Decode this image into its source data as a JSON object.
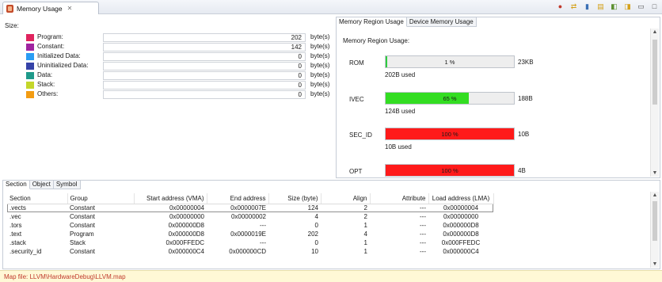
{
  "view": {
    "title": "Memory Usage",
    "close_icon": "close-icon"
  },
  "toolbar": {
    "icons": [
      "refresh-icon",
      "link-icon",
      "filter-icon",
      "export-icon",
      "collapse-icon",
      "expand-icon",
      "minimize-icon",
      "maximize-icon"
    ]
  },
  "size": {
    "title": "Size:",
    "unit": "byte(s)",
    "rows": [
      {
        "label": "Program:",
        "value": "202",
        "color": "#e0245e"
      },
      {
        "label": "Constant:",
        "value": "142",
        "color": "#a024a0"
      },
      {
        "label": "Initialized Data:",
        "value": "0",
        "color": "#2a9df4"
      },
      {
        "label": "Uninitialized Data:",
        "value": "0",
        "color": "#3543a8"
      },
      {
        "label": "Data:",
        "value": "0",
        "color": "#1f9a8a"
      },
      {
        "label": "Stack:",
        "value": "0",
        "color": "#c4d62a"
      },
      {
        "label": "Others:",
        "value": "0",
        "color": "#f39c12"
      }
    ]
  },
  "region": {
    "tabs": [
      "Memory Region Usage",
      "Device Memory Usage"
    ],
    "title": "Memory Region Usage:",
    "items": [
      {
        "name": "ROM",
        "percent_label": "1 %",
        "fill_fraction": 0.01,
        "fill_color": "#2ecc40",
        "size": "23KB",
        "used": "202B used"
      },
      {
        "name": "IVEC",
        "percent_label": "65 %",
        "fill_fraction": 0.65,
        "fill_color": "#33dd22",
        "size": "188B",
        "used": "124B used"
      },
      {
        "name": "SEC_ID",
        "percent_label": "100 %",
        "fill_fraction": 1.0,
        "fill_color": "#ff1a1a",
        "size": "10B",
        "used": "10B used"
      },
      {
        "name": "OPT",
        "percent_label": "100 %",
        "fill_fraction": 1.0,
        "fill_color": "#ff1a1a",
        "size": "4B",
        "used": ""
      }
    ]
  },
  "bottom": {
    "tabs": [
      "Section",
      "Object",
      "Symbol"
    ],
    "columns": [
      "Section",
      "Group",
      "Start address (VMA)",
      "End address",
      "Size (byte)",
      "Align",
      "Attribute",
      "Load address (LMA)"
    ],
    "rows": [
      [
        ".vects",
        "Constant",
        "0x00000004",
        "0x0000007E",
        "124",
        "2",
        "---",
        "0x00000004"
      ],
      [
        ".vec",
        "Constant",
        "0x00000000",
        "0x00000002",
        "4",
        "2",
        "---",
        "0x00000000"
      ],
      [
        ".tors",
        "Constant",
        "0x000000D8",
        "---",
        "0",
        "1",
        "---",
        "0x000000D8"
      ],
      [
        ".text",
        "Program",
        "0x000000D8",
        "0x0000019E",
        "202",
        "4",
        "---",
        "0x000000D8"
      ],
      [
        ".stack",
        "Stack",
        "0x000FFEDC",
        "---",
        "0",
        "1",
        "---",
        "0x000FFEDC"
      ],
      [
        ".security_id",
        "Constant",
        "0x000000C4",
        "0x000000CD",
        "10",
        "1",
        "---",
        "0x000000C4"
      ]
    ]
  },
  "status": {
    "text": "Map file: LLVM\\HardwareDebug\\LLVM.map"
  }
}
